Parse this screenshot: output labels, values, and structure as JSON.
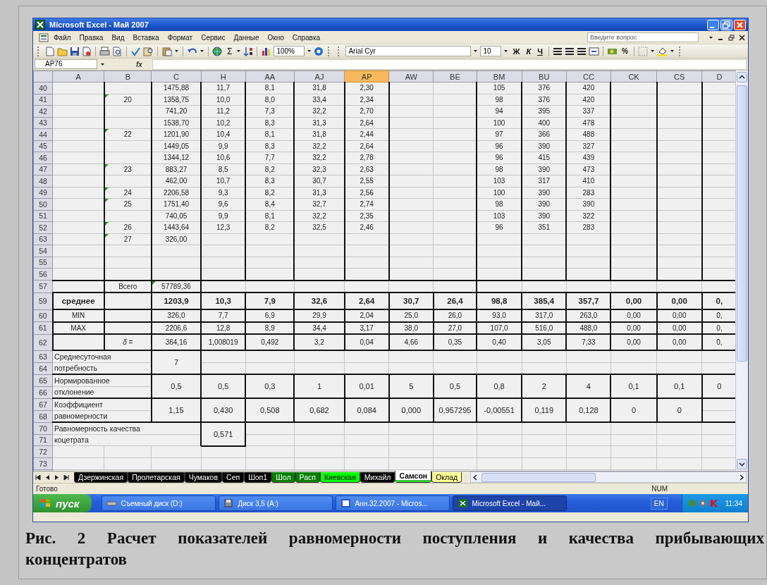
{
  "window": {
    "title": "Microsoft Excel - Май 2007"
  },
  "menu": [
    "Файл",
    "Правка",
    "Вид",
    "Вставка",
    "Формат",
    "Сервис",
    "Данные",
    "Окно",
    "Справка"
  ],
  "help_search": {
    "placeholder": "Введите вопрос"
  },
  "toolbar": {
    "sum": "Σ",
    "zoom": "100%",
    "font": "Arial Cyr",
    "size": "10",
    "bold": "Ж",
    "italic": "К",
    "underline": "Ч",
    "percent": "%"
  },
  "formula_bar": {
    "name_box": "AP76",
    "fx": "fx"
  },
  "sheet": {
    "columns": [
      {
        "label": "A",
        "selected": false
      },
      {
        "label": "B",
        "selected": false
      },
      {
        "label": "C",
        "selected": false
      },
      {
        "label": "H",
        "selected": false
      },
      {
        "label": "AA",
        "selected": false
      },
      {
        "label": "AJ",
        "selected": false
      },
      {
        "label": "AP",
        "selected": true
      },
      {
        "label": "AW",
        "selected": false
      },
      {
        "label": "BE",
        "selected": false
      },
      {
        "label": "BM",
        "selected": false
      },
      {
        "label": "BU",
        "selected": false
      },
      {
        "label": "CC",
        "selected": false
      },
      {
        "label": "CK",
        "selected": false
      },
      {
        "label": "CS",
        "selected": false
      },
      {
        "label": "D",
        "selected": false
      }
    ],
    "rows": [
      {
        "number": "40",
        "kind": "data",
        "cells": [
          null,
          null,
          "1475,88",
          "11,7",
          "8,1",
          "31,8",
          "2,30",
          null,
          null,
          "105",
          "376",
          "420"
        ]
      },
      {
        "number": "41",
        "kind": "data",
        "cells": [
          null,
          {
            "text": "20",
            "flagged": true
          },
          "1358,75",
          "10,0",
          "8,0",
          "33,4",
          "2,34",
          null,
          null,
          "98",
          "376",
          "420"
        ]
      },
      {
        "number": "42",
        "kind": "data",
        "cells": [
          null,
          null,
          "741,20",
          "11,2",
          "7,3",
          "32,2",
          "2,70",
          null,
          null,
          "94",
          "395",
          "337"
        ]
      },
      {
        "number": "43",
        "kind": "data",
        "cells": [
          null,
          null,
          "1538,70",
          "10,2",
          "8,3",
          "31,3",
          "2,64",
          null,
          null,
          "100",
          "400",
          "478"
        ]
      },
      {
        "number": "44",
        "kind": "data",
        "cells": [
          null,
          {
            "text": "22",
            "flagged": true
          },
          "1201,90",
          "10,4",
          "8,1",
          "31,8",
          "2,44",
          null,
          null,
          "97",
          "366",
          "488"
        ]
      },
      {
        "number": "45",
        "kind": "data",
        "cells": [
          null,
          null,
          "1449,05",
          "9,9",
          "8,3",
          "32,2",
          "2,64",
          null,
          null,
          "96",
          "390",
          "327"
        ]
      },
      {
        "number": "46",
        "kind": "data",
        "cells": [
          null,
          null,
          "1344,12",
          "10,6",
          "7,7",
          "32,2",
          "2,78",
          null,
          null,
          "96",
          "415",
          "439"
        ]
      },
      {
        "number": "47",
        "kind": "data",
        "cells": [
          null,
          {
            "text": "23",
            "flagged": true
          },
          "883,27",
          "8,5",
          "8,2",
          "32,3",
          "2,63",
          null,
          null,
          "98",
          "390",
          "473"
        ]
      },
      {
        "number": "48",
        "kind": "data",
        "cells": [
          null,
          null,
          "462,00",
          "10,7",
          "8,3",
          "30,7",
          "2,55",
          null,
          null,
          "103",
          "317",
          "410"
        ]
      },
      {
        "number": "49",
        "kind": "data",
        "cells": [
          null,
          {
            "text": "24",
            "flagged": true
          },
          "2206,58",
          "9,3",
          "8,2",
          "31,3",
          "2,56",
          null,
          null,
          "100",
          "390",
          "283"
        ]
      },
      {
        "number": "50",
        "kind": "data",
        "cells": [
          null,
          {
            "text": "25",
            "flagged": true
          },
          "1751,40",
          "9,6",
          "8,4",
          "32,7",
          "2,74",
          null,
          null,
          "98",
          "390",
          "390"
        ]
      },
      {
        "number": "51",
        "kind": "data",
        "cells": [
          null,
          null,
          "740,05",
          "9,9",
          "8,1",
          "32,2",
          "2,35",
          null,
          null,
          "103",
          "390",
          "322"
        ]
      },
      {
        "number": "52",
        "kind": "data",
        "cells": [
          null,
          {
            "text": "26",
            "flagged": true
          },
          "1443,64",
          "12,3",
          "8,2",
          "32,5",
          "2,46",
          null,
          null,
          "96",
          "351",
          "283"
        ]
      },
      {
        "number": "63",
        "kind": "data",
        "cells": [
          null,
          {
            "text": "27",
            "flagged": true
          },
          "326,00"
        ]
      },
      {
        "number": "54",
        "kind": "data",
        "cells": []
      },
      {
        "number": "55",
        "kind": "data",
        "cells": []
      },
      {
        "number": "56",
        "kind": "data",
        "cells": []
      },
      {
        "number": "57",
        "kind": "total",
        "cells": [
          null,
          "Всего",
          {
            "text": "57789,36",
            "flagged": true
          }
        ]
      },
      {
        "number": "59",
        "kind": "average",
        "cells": [
          "среднее",
          null,
          "1203,9",
          "10,3",
          "7,9",
          "32,6",
          "2,64",
          "30,7",
          "26,4",
          "98,8",
          "385,4",
          "357,7",
          "0,00",
          "0,00",
          "0,"
        ]
      },
      {
        "number": "60",
        "kind": "stat",
        "cells": [
          "MIN",
          null,
          "326,0",
          "7,7",
          "6,9",
          "29,9",
          "2,04",
          "25,0",
          "26,0",
          "93,0",
          "317,0",
          "263,0",
          "0,00",
          "0,00",
          "0,"
        ]
      },
      {
        "number": "61",
        "kind": "stat",
        "cells": [
          "MAX",
          null,
          "2206,6",
          "12,8",
          "8,9",
          "34,4",
          "3,17",
          "38,0",
          "27,0",
          "107,0",
          "516,0",
          "488,0",
          "0,00",
          "0,00",
          "0,"
        ]
      },
      {
        "number": "62",
        "kind": "delta",
        "cells": [
          null,
          "*δ* =",
          "364,16",
          "1,008019",
          "0,492",
          "3,2",
          "0,04",
          "4,66",
          "0,35",
          "0,40",
          "3,05",
          "7,33",
          "0,00",
          "0,00",
          "0,"
        ]
      }
    ],
    "blocks": [
      {
        "numbers": [
          "63",
          "64"
        ],
        "lines": [
          "Среднесуточная",
          "потребность"
        ],
        "cells": [
          null,
          null,
          "7"
        ]
      },
      {
        "numbers": [
          "65",
          "66"
        ],
        "lines": [
          "Нормированное",
          "отклонение"
        ],
        "cells": [
          null,
          null,
          "0,5",
          "0,5",
          "0,3",
          "1",
          "0,01",
          "5",
          "0,5",
          "0,8",
          "2",
          "4",
          "0,1",
          "0,1",
          "0"
        ]
      },
      {
        "numbers": [
          "67",
          "68"
        ],
        "lines": [
          "Коэффициент",
          "равномерности"
        ],
        "cells": [
          null,
          null,
          "1,15",
          "0,430",
          "0,508",
          "0,682",
          "0,084",
          "0,000",
          "0,957295",
          "-0,00551",
          "0,119",
          "0,128",
          "0",
          "0"
        ]
      },
      {
        "numbers": [
          "70",
          "71"
        ],
        "lines": [
          "Равномерность качества",
          "коцетрата"
        ],
        "cells": [
          null,
          null,
          null,
          "0,571"
        ]
      }
    ],
    "tail_rows": [
      "72",
      "73"
    ]
  },
  "sheet_tabs": [
    {
      "label": "Дзержинская",
      "color": "#000000",
      "selected": false
    },
    {
      "label": "Пролетарская",
      "color": "#000000",
      "selected": false
    },
    {
      "label": "Чумаков",
      "color": "#000000",
      "selected": false
    },
    {
      "label": "Сеп",
      "color": "#000000",
      "selected": false
    },
    {
      "label": "Шоп1",
      "color": "#000000",
      "selected": false
    },
    {
      "label": "Шол",
      "color": "#008000",
      "selected": false
    },
    {
      "label": "Расп",
      "color": "#008000",
      "selected": false
    },
    {
      "label": "Киевская",
      "color": "#00ff00",
      "selected": false
    },
    {
      "label": "Михайл",
      "color": "#000000",
      "selected": false
    },
    {
      "label": "Самсон",
      "color": "#33cc33",
      "selected": true
    },
    {
      "label": "Оклад",
      "color": "#ffff99",
      "selected": false
    }
  ],
  "status_bar": {
    "message": "Готово",
    "num": "NUM"
  },
  "taskbar": {
    "start": "пуск",
    "buttons": [
      {
        "label": "Съемный диск (D:)",
        "selected": false
      },
      {
        "label": "Диск 3,5 (A:)",
        "selected": false
      },
      {
        "label": "Анн.32.2007 - Micros...",
        "selected": false
      },
      {
        "label": "Microsoft Excel - Май...",
        "selected": true
      }
    ],
    "language": "EN",
    "clock": "11:34"
  },
  "caption": "Рис. 2 Расчет показателей равномерности поступления и качества прибывающих концентратов"
}
